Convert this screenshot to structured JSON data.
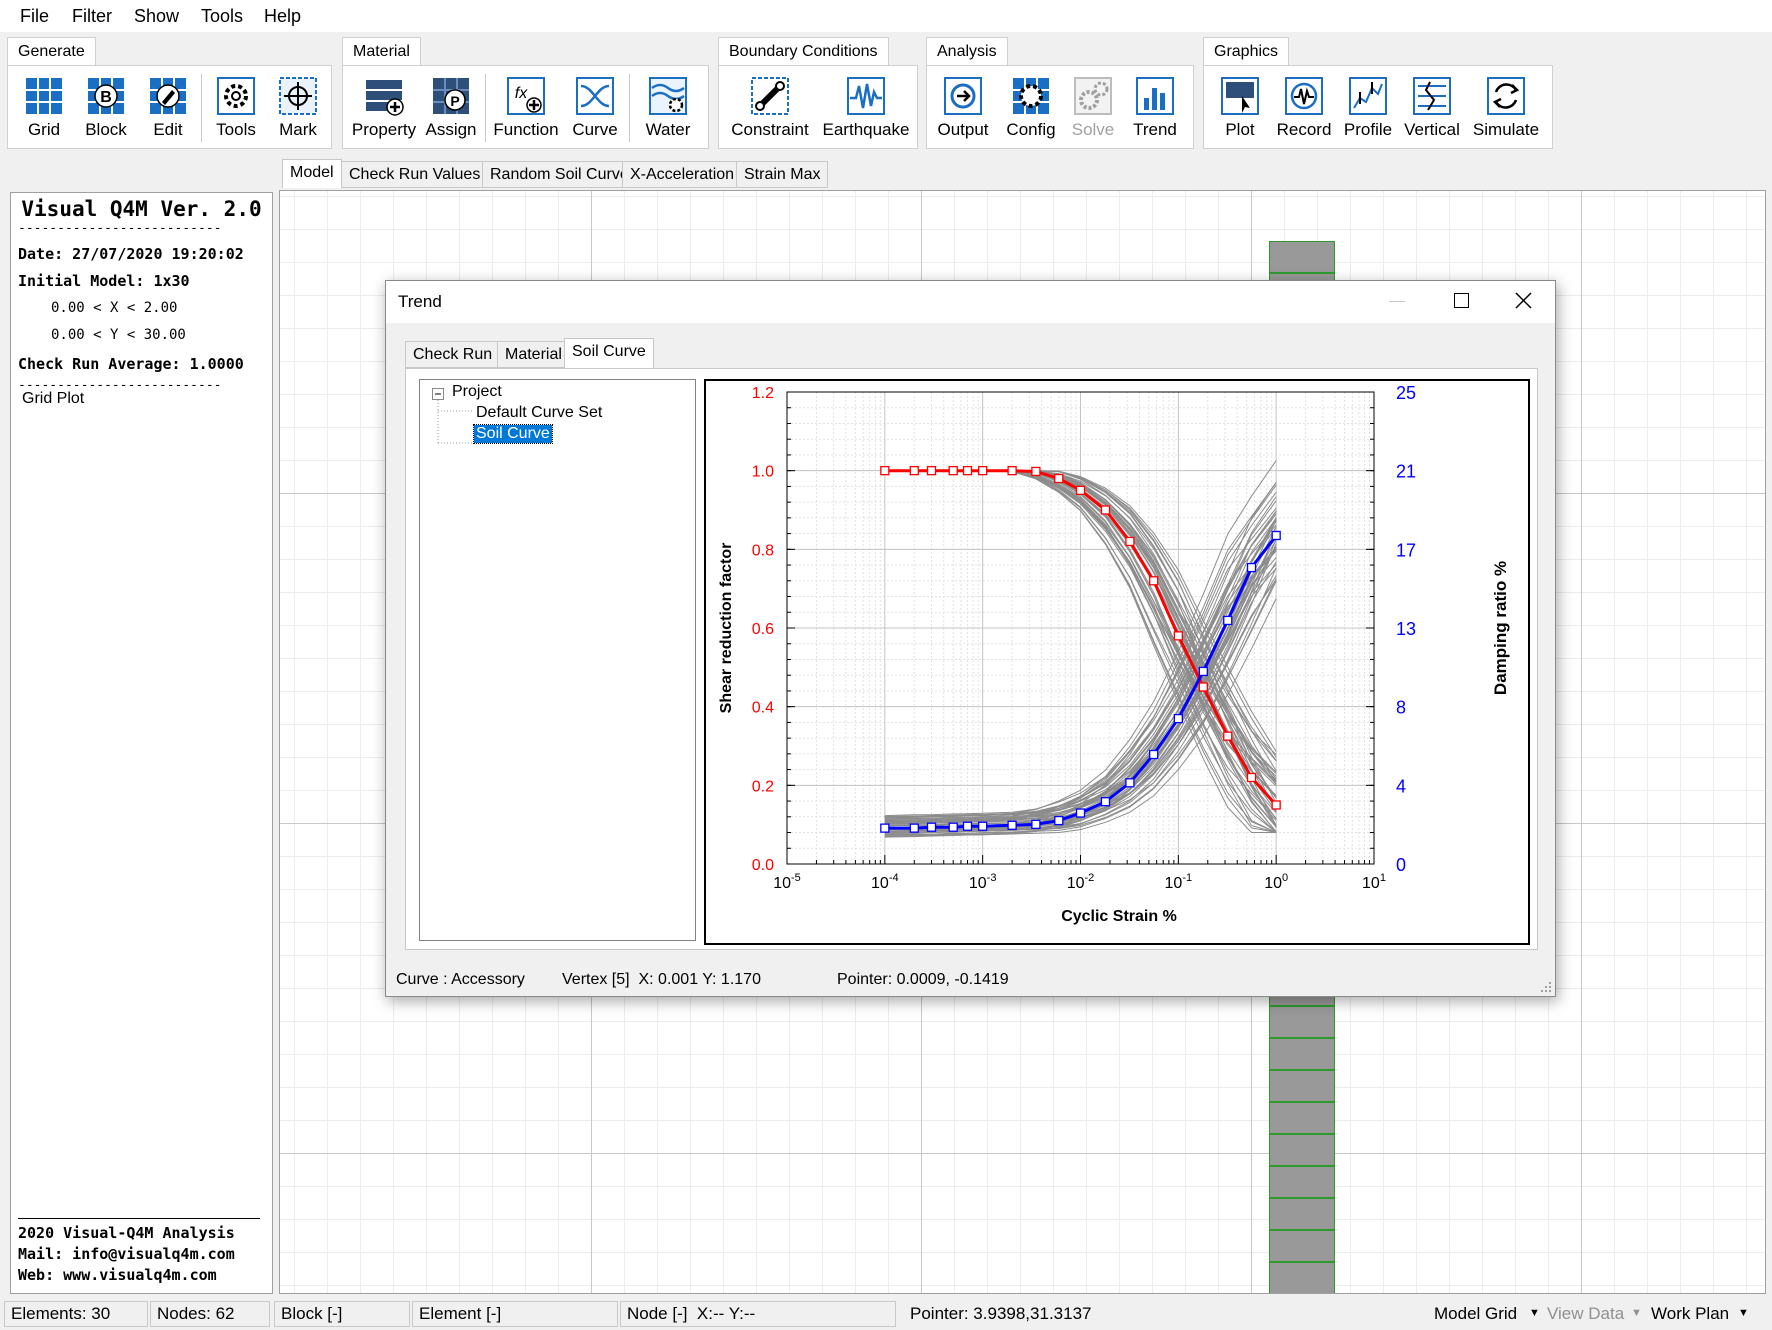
{
  "menu": [
    "File",
    "Filter",
    "Show",
    "Tools",
    "Help"
  ],
  "ribbon": {
    "groups": [
      "Generate",
      "Material",
      "Boundary Conditions",
      "Analysis",
      "Graphics"
    ],
    "buttons": {
      "grid": "Grid",
      "block": "Block",
      "edit": "Edit",
      "tools": "Tools",
      "mark": "Mark",
      "property": "Property",
      "assign": "Assign",
      "function": "Function",
      "curve": "Curve",
      "water": "Water",
      "constraint": "Constraint",
      "earthquake": "Earthquake",
      "output": "Output",
      "config": "Config",
      "solve": "Solve",
      "trend": "Trend",
      "plot": "Plot",
      "record": "Record",
      "profile": "Profile",
      "vertical": "Vertical",
      "simulate": "Simulate"
    }
  },
  "doc_tabs": [
    "Model",
    "Check Run Values",
    "Random Soil Curve",
    "X-Acceleration",
    "Strain Max"
  ],
  "left_panel": {
    "title": "Visual Q4M Ver. 2.0",
    "rule": "--------------------------",
    "date": "Date: 27/07/2020 19:20:02",
    "initial_model": "Initial Model: 1x30",
    "x_range": "0.00 < X < 2.00",
    "y_range": "0.00 < Y < 30.00",
    "check_run": "Check Run Average: 1.0000",
    "grid_plot": "Grid Plot",
    "footer1": "2020 Visual-Q4M Analysis",
    "footer2": "Mail: info@visualq4m.com",
    "footer3": "Web: www.visualq4m.com"
  },
  "dialog": {
    "title": "Trend",
    "tabs": [
      "Check Run",
      "Material",
      "Soil Curve"
    ],
    "tree": {
      "root": "Project",
      "children": [
        "Default Curve Set",
        "Soil Curve"
      ]
    },
    "status": {
      "curve": "Curve : Accessory",
      "vertex": "Vertex [5]  X: 0.001 Y: 1.170",
      "pointer": "Pointer: 0.0009, -0.1419"
    }
  },
  "status_bar": {
    "elements": "Elements: 30",
    "nodes": "Nodes: 62",
    "block": "Block [-]",
    "element": "Element [-]",
    "node": "Node [-]  X:-- Y:--",
    "pointer": "Pointer: 3.9398,31.3137",
    "model_grid": "Model Grid",
    "view_data": "View Data",
    "work_plan": "Work Plan"
  },
  "colors": {
    "red": "#ff0000",
    "blue": "#0000ff",
    "gray": "#8c8c8c",
    "select": "#0078d7"
  },
  "chart_data": {
    "type": "line",
    "xscale": "log",
    "xlim": [
      1e-05,
      10
    ],
    "xticks": [
      "10^-5",
      "10^-4",
      "10^-3",
      "10^-2",
      "10^-1",
      "10^0",
      "10^1"
    ],
    "xlabel": "Cyclic Strain %",
    "ylabel_left": "Shear reduction factor",
    "ylabel_right": "Damping ratio %",
    "ylim_left": [
      0,
      1.2
    ],
    "yticks_left": [
      "0.0",
      "0.2",
      "0.4",
      "0.6",
      "0.8",
      "1.0",
      "1.2"
    ],
    "ylim_right": [
      0,
      25
    ],
    "yticks_right": [
      "0",
      "4",
      "8",
      "13",
      "17",
      "21",
      "25"
    ],
    "grid": true,
    "x": [
      0.0001,
      0.0002,
      0.0003,
      0.0005,
      0.0007,
      0.001,
      0.002,
      0.0035,
      0.006,
      0.01,
      0.018,
      0.032,
      0.056,
      0.1,
      0.18,
      0.32,
      0.56,
      1.0
    ],
    "series": [
      {
        "name": "",
        "axis": "left",
        "color": "#ff0000",
        "values": [
          1.0,
          1.0,
          1.0,
          1.0,
          1.0,
          1.0,
          1.0,
          0.998,
          0.98,
          0.95,
          0.9,
          0.82,
          0.72,
          0.58,
          0.45,
          0.325,
          0.22,
          0.15
        ]
      },
      {
        "name": "",
        "axis": "right",
        "color": "#0000ff",
        "values": [
          1.9,
          1.9,
          1.95,
          1.95,
          2.0,
          2.0,
          2.05,
          2.1,
          2.3,
          2.7,
          3.3,
          4.3,
          5.8,
          7.7,
          10.2,
          12.9,
          15.7,
          17.4
        ]
      }
    ]
  }
}
